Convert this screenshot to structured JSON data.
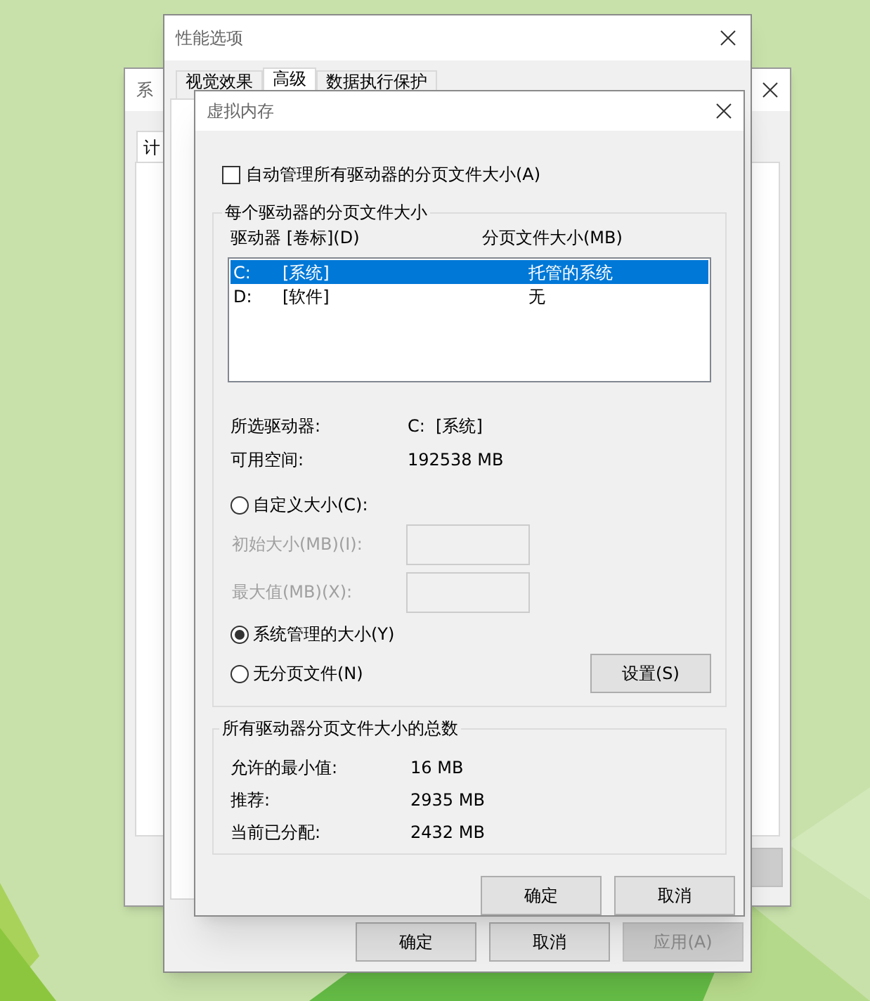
{
  "system_window": {
    "title": "系",
    "tabs": [
      {
        "label": "计",
        "selected": true
      }
    ]
  },
  "performance_window": {
    "title": "性能选项",
    "tabs": [
      {
        "label": "视觉效果",
        "selected": false
      },
      {
        "label": "高级",
        "selected": true
      },
      {
        "label": "数据执行保护",
        "selected": false
      }
    ],
    "buttons": [
      {
        "label": "确定",
        "disabled": false
      },
      {
        "label": "取消",
        "disabled": false
      },
      {
        "label": "应用(A)",
        "disabled": true
      }
    ]
  },
  "virtual_memory_dialog": {
    "title": "虚拟内存",
    "auto_manage": {
      "label": "自动管理所有驱动器的分页文件大小(A)",
      "checked": false
    },
    "per_drive": {
      "title": "每个驱动器的分页文件大小",
      "columns": [
        "驱动器 [卷标](D)",
        "分页文件大小(MB)"
      ],
      "rows": [
        {
          "drive": "C:",
          "volume": "[系统]",
          "size": "托管的系统",
          "selected": true
        },
        {
          "drive": "D:",
          "volume": "[软件]",
          "size": "无",
          "selected": false
        }
      ],
      "selected_drive": {
        "label": "所选驱动器:",
        "value": "C:  [系统]"
      },
      "free_space": {
        "label": "可用空间:",
        "value": "192538 MB"
      },
      "options": [
        {
          "kind": "radio",
          "label": "自定义大小(C):",
          "selected": false
        },
        {
          "kind": "field",
          "label": "初始大小(MB)(I):",
          "disabled": true
        },
        {
          "kind": "field",
          "label": "最大值(MB)(X):",
          "disabled": true
        },
        {
          "kind": "radio",
          "label": "系统管理的大小(Y)",
          "selected": true
        },
        {
          "kind": "radio",
          "label": "无分页文件(N)",
          "selected": false
        }
      ],
      "set_button": "设置(S)"
    },
    "totals": {
      "title": "所有驱动器分页文件大小的总数",
      "rows": [
        {
          "label": "允许的最小值:",
          "value": "16 MB"
        },
        {
          "label": "推荐:",
          "value": "2935 MB"
        },
        {
          "label": "当前已分配:",
          "value": "2432 MB"
        }
      ]
    },
    "buttons": [
      "确定",
      "取消"
    ]
  }
}
